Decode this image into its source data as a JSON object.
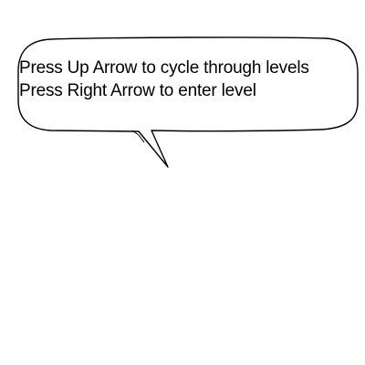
{
  "dialog": {
    "lines": [
      "Press Up Arrow to cycle through levels",
      "Press Right Arrow to enter level"
    ]
  },
  "colors": {
    "background": "#ffffff",
    "bubble_fill": "#ffffff",
    "bubble_stroke": "#000000",
    "text": "#000000"
  }
}
